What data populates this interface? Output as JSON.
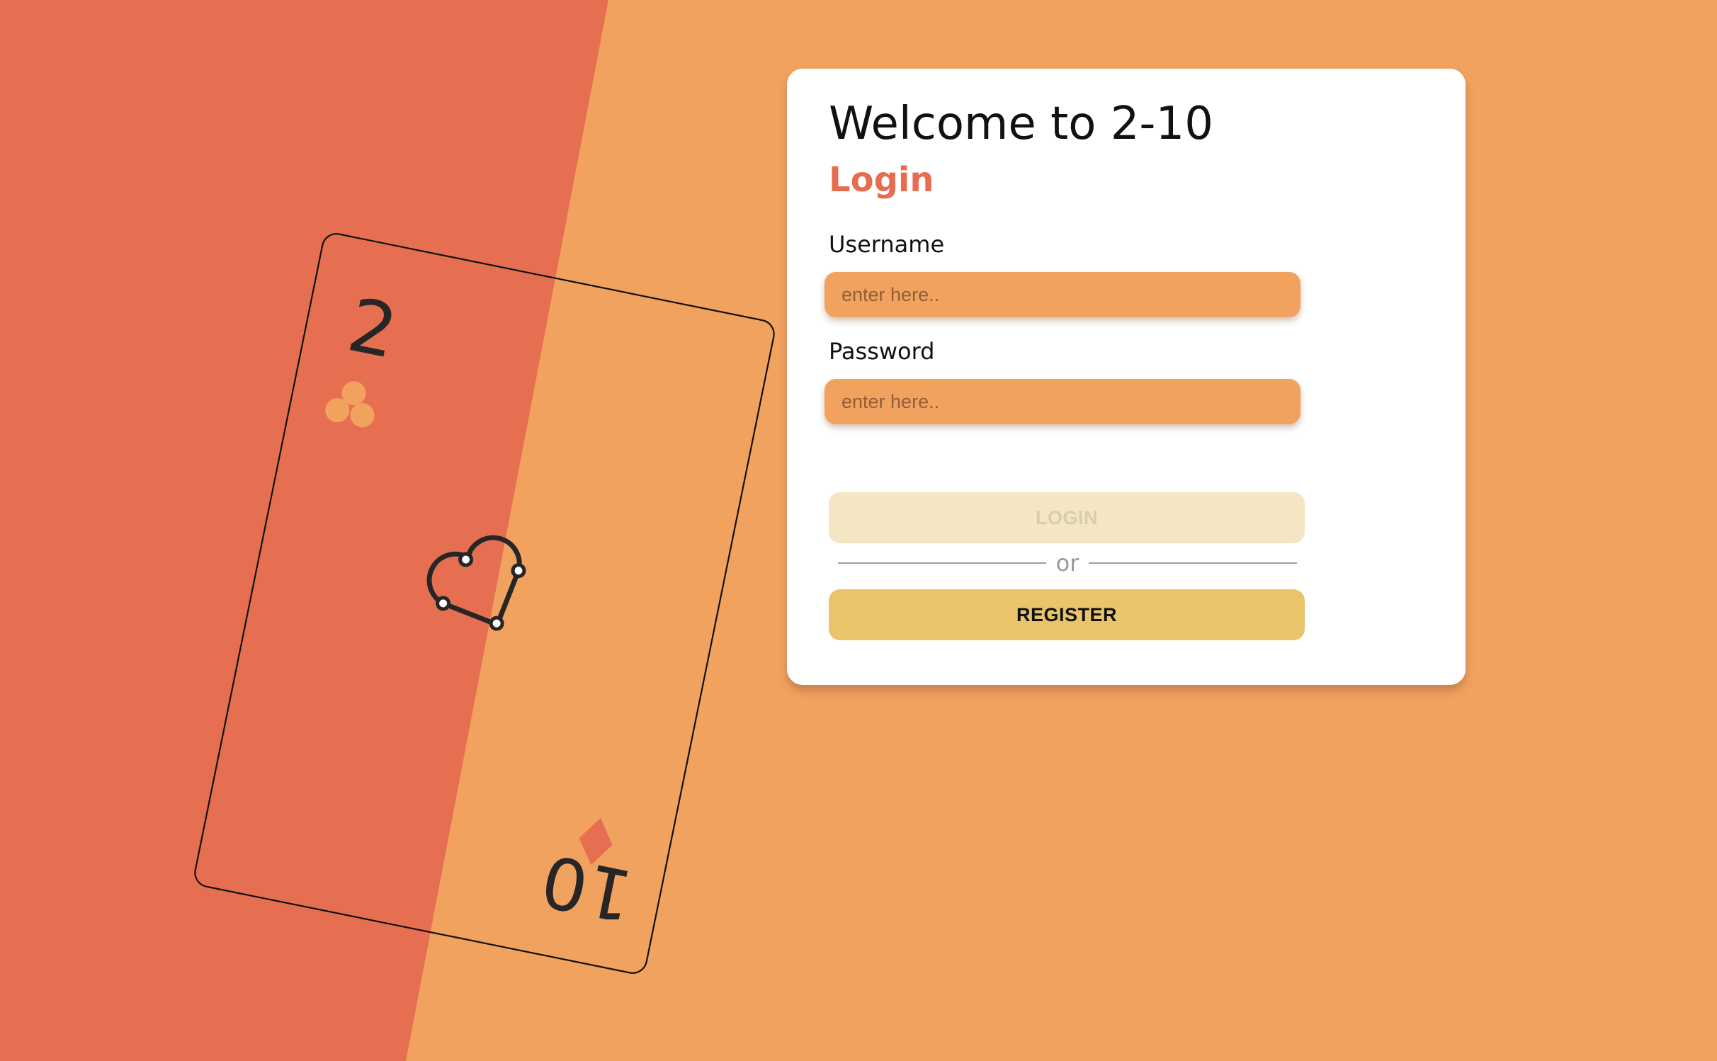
{
  "theme": {
    "background_left": "#E76F51",
    "background_right": "#F2A25F",
    "accent": "#E56E50",
    "card_outline": "#111111",
    "icon_dark": "#262626",
    "login_button_bg": "#F5E6C3",
    "register_button_bg": "#E9C46A"
  },
  "decoration": {
    "card": {
      "top_rank": "2",
      "bottom_rank": "10",
      "top_suit_icon": "club-icon",
      "bottom_suit_icon": "diamond-icon",
      "center_icon": "heart-line-icon"
    }
  },
  "login_panel": {
    "title": "Welcome to 2-10",
    "subtitle": "Login",
    "username": {
      "label": "Username",
      "value": "",
      "placeholder": "enter here.."
    },
    "password": {
      "label": "Password",
      "value": "",
      "placeholder": "enter here.."
    },
    "login_button": "LOGIN",
    "divider_text": "or",
    "register_button": "REGISTER"
  }
}
